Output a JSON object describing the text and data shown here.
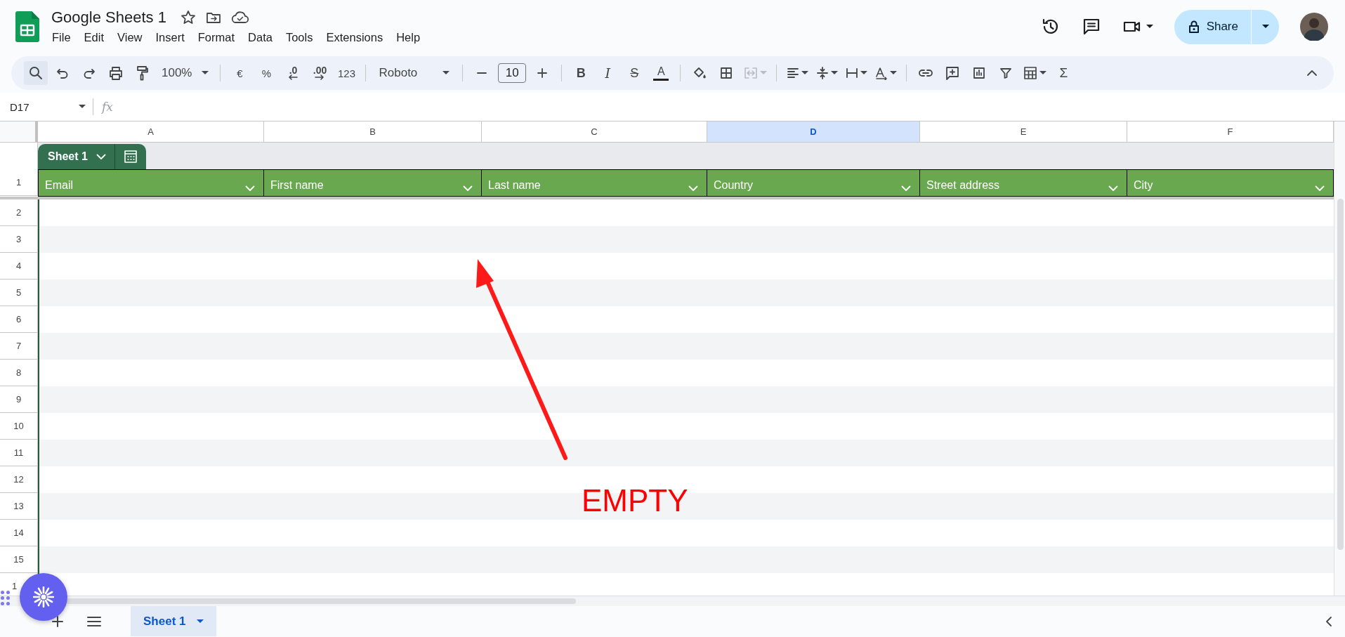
{
  "app": {
    "title": "Google Sheets 1"
  },
  "menu": [
    "File",
    "Edit",
    "View",
    "Insert",
    "Format",
    "Data",
    "Tools",
    "Extensions",
    "Help"
  ],
  "share": {
    "label": "Share"
  },
  "toolbar": {
    "zoom": "100%",
    "currency": "€",
    "percent": "%",
    "decimal_decrease": ".0",
    "decimal_increase": ".00",
    "number_format": "123",
    "font": "Roboto",
    "font_size": "10",
    "bold": "B",
    "italic": "I",
    "strikethrough": "S",
    "text_color": "A",
    "functions": "Σ"
  },
  "formula_bar": {
    "cell_reference": "D17",
    "fx": "fx"
  },
  "columns": [
    {
      "letter": "A",
      "selected": false
    },
    {
      "letter": "B",
      "selected": false
    },
    {
      "letter": "C",
      "selected": false
    },
    {
      "letter": "D",
      "selected": true
    },
    {
      "letter": "E",
      "selected": false
    },
    {
      "letter": "F",
      "selected": false
    }
  ],
  "table": {
    "name": "Sheet 1",
    "fields": [
      "Email",
      "First name",
      "Last name",
      "Country",
      "Street address",
      "City"
    ]
  },
  "row_numbers": [
    "1",
    "2",
    "3",
    "4",
    "5",
    "6",
    "7",
    "8",
    "9",
    "10",
    "11",
    "12",
    "13",
    "14",
    "15",
    "1"
  ],
  "annotation": {
    "text": "EMPTY"
  },
  "sheet_tabs": [
    {
      "label": "Sheet 1",
      "selected": true
    }
  ]
}
